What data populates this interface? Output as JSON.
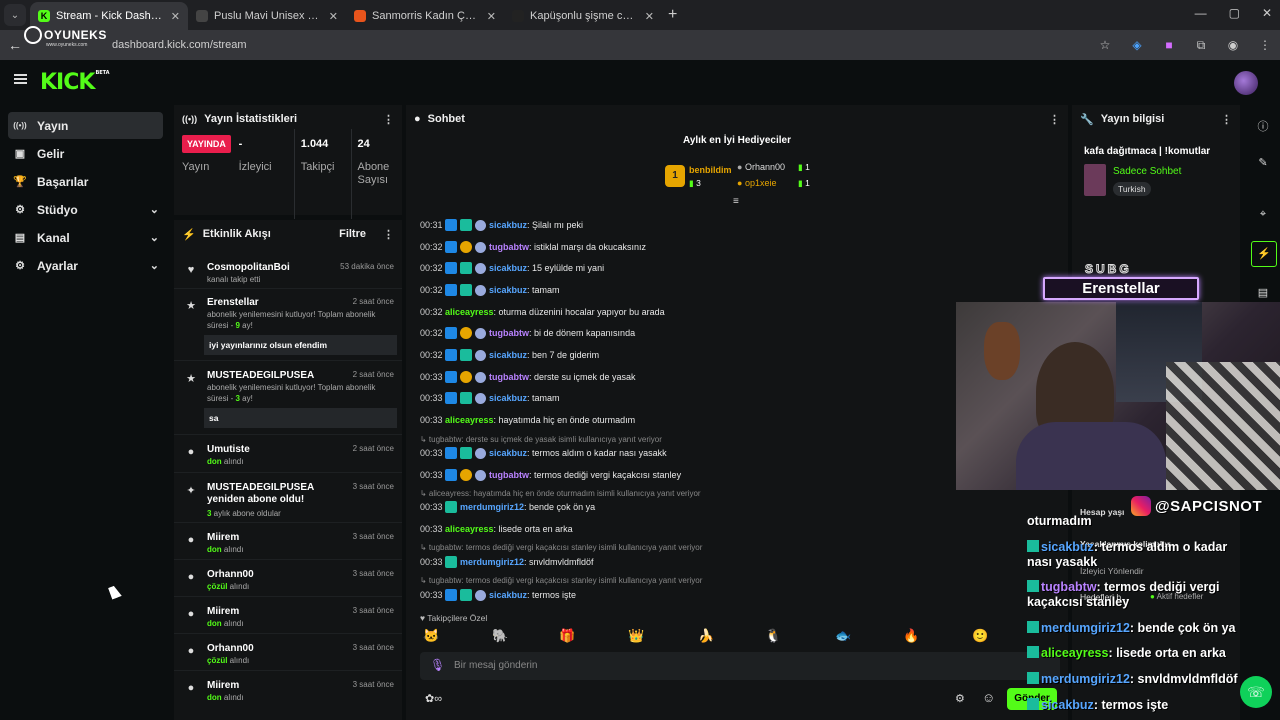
{
  "browser": {
    "tabs": [
      {
        "label": "Stream - Kick Dashboard",
        "favicon_color": "#53fc18",
        "favicon_glyph": "K"
      },
      {
        "label": "Puslu Mavi Unisex Çanta Mecl",
        "favicon_color": "#444444",
        "favicon_glyph": ""
      },
      {
        "label": "Sanmorris Kadın Çok Gözlü Kul",
        "favicon_color": "#e8541c",
        "favicon_glyph": ""
      },
      {
        "label": "Kapüşonlu şişme ceket - Cekel",
        "favicon_color": "#222222",
        "favicon_glyph": ""
      }
    ],
    "url": "dashboard.kick.com/stream",
    "watermark": {
      "name": "OYUNEKS",
      "sub": "www.oyuneks.com"
    }
  },
  "kick": {
    "logo": "KICK",
    "logo_tag": "BETA"
  },
  "sidebar": {
    "items": [
      {
        "label": "Yayın",
        "icon": "broadcast-icon",
        "glyph": "((•))",
        "chevron": false
      },
      {
        "label": "Gelir",
        "icon": "money-icon",
        "glyph": "▣",
        "chevron": false
      },
      {
        "label": "Başarılar",
        "icon": "trophy-icon",
        "glyph": "🏆",
        "chevron": false
      },
      {
        "label": "Stüdyo",
        "icon": "studio-icon",
        "glyph": "⚙",
        "chevron": true
      },
      {
        "label": "Kanal",
        "icon": "channel-icon",
        "glyph": "▤",
        "chevron": true
      },
      {
        "label": "Ayarlar",
        "icon": "settings-icon",
        "glyph": "⚙",
        "chevron": true
      }
    ]
  },
  "stats": {
    "title": "Yayın İstatistikleri",
    "live": "YAYINDA",
    "live_label": "Yayın",
    "viewers_value": "-",
    "viewers_label": "İzleyici",
    "followers_value": "1.044",
    "followers_label": "Takipçi",
    "subs_value": "24",
    "subs_label": "Abone Sayısı"
  },
  "activity": {
    "title": "Etkinlik Akışı",
    "filter": "Filtre",
    "items": [
      {
        "icon": "♥",
        "name": "CosmopolitanBoi",
        "time": "53 dakika önce",
        "desc": "kanalı takip etti",
        "msg": ""
      },
      {
        "icon": "★",
        "name": "Erenstellar",
        "time": "2 saat önce",
        "desc": "abonelik yenilemesini kutluyor! Toplam abonelik süresi -",
        "count": "9",
        "suffix": " ay!",
        "msg": "iyi yayınlarınız olsun efendim"
      },
      {
        "icon": "★",
        "name": "MUSTEADEGILPUSEA",
        "time": "2 saat önce",
        "desc": "abonelik yenilemesini kutluyor! Toplam abonelik süresi -",
        "count": "3",
        "suffix": " ay!",
        "msg": "sa"
      },
      {
        "icon": "●",
        "name": "Umutiste",
        "time": "2 saat önce",
        "gift": "don",
        "desc": " alındı",
        "msg": ""
      },
      {
        "icon": "✦",
        "name": "MUSTEADEGILPUSEA yeniden abone oldu!",
        "time": "3 saat önce",
        "count": "3",
        "desc": " aylık abone oldular",
        "msg": ""
      },
      {
        "icon": "●",
        "name": "Miirem",
        "time": "3 saat önce",
        "gift": "don",
        "desc": " alındı",
        "msg": ""
      },
      {
        "icon": "●",
        "name": "Orhann00",
        "time": "3 saat önce",
        "gift": "çözül",
        "desc": " alındı",
        "msg": ""
      },
      {
        "icon": "●",
        "name": "Miirem",
        "time": "3 saat önce",
        "gift": "don",
        "desc": " alındı",
        "msg": ""
      },
      {
        "icon": "●",
        "name": "Orhann00",
        "time": "3 saat önce",
        "gift": "çözül",
        "desc": " alındı",
        "msg": ""
      },
      {
        "icon": "●",
        "name": "Miirem",
        "time": "3 saat önce",
        "gift": "don",
        "desc": " alındı",
        "msg": ""
      }
    ]
  },
  "chat": {
    "title": "Sohbet",
    "top_gifters_title": "Aylık en İyi Hediyeciler",
    "gifters": [
      {
        "rank": "1",
        "name": "benbildim",
        "count": "3"
      },
      {
        "rank": "",
        "name": "Orhann00",
        "count": "1"
      },
      {
        "rank": "",
        "name": "op1xeie",
        "count": "1"
      }
    ],
    "messages": [
      {
        "ts": "00:31",
        "badges": [
          "blue",
          "cyan",
          "snow"
        ],
        "user": "sicakbuz",
        "color": "#57a6ff",
        "text": ": Şilalı mı peki"
      },
      {
        "ts": "00:32",
        "badges": [
          "blue",
          "gold",
          "snow"
        ],
        "user": "tugbabtw",
        "color": "#b983ff",
        "text": ": istiklal marşı da okucaksınız"
      },
      {
        "ts": "00:32",
        "badges": [
          "blue",
          "cyan",
          "snow"
        ],
        "user": "sicakbuz",
        "color": "#57a6ff",
        "text": ": 15 eylülde mi yani"
      },
      {
        "ts": "00:32",
        "badges": [
          "blue",
          "cyan",
          "snow"
        ],
        "user": "sicakbuz",
        "color": "#57a6ff",
        "text": ": tamam"
      },
      {
        "ts": "00:32",
        "badges": [],
        "user": "aliceayress",
        "color": "#53fc18",
        "text": ": oturma düzenini hocalar yapıyor bu arada"
      },
      {
        "ts": "00:32",
        "badges": [
          "blue",
          "gold",
          "snow"
        ],
        "user": "tugbabtw",
        "color": "#b983ff",
        "text": ": bi de dönem kapanısında"
      },
      {
        "ts": "00:32",
        "badges": [
          "blue",
          "cyan",
          "snow"
        ],
        "user": "sicakbuz",
        "color": "#57a6ff",
        "text": ": ben 7 de giderim"
      },
      {
        "ts": "00:33",
        "badges": [
          "blue",
          "gold",
          "snow"
        ],
        "user": "tugbabtw",
        "color": "#b983ff",
        "text": ": derste su içmek de yasak"
      },
      {
        "ts": "00:33",
        "badges": [
          "blue",
          "cyan",
          "snow"
        ],
        "user": "sicakbuz",
        "color": "#57a6ff",
        "text": ": tamam"
      },
      {
        "ts": "00:33",
        "badges": [],
        "user": "aliceayress",
        "color": "#53fc18",
        "text": ": hayatımda hiç en önde oturmadım"
      },
      {
        "reply": "↳ tugbabtw: derste su içmek de yasak isimli kullanıcıya yanıt veriyor"
      },
      {
        "ts": "00:33",
        "badges": [
          "blue",
          "cyan",
          "snow"
        ],
        "user": "sicakbuz",
        "color": "#57a6ff",
        "text": ": termos aldım o kadar nası yasakk"
      },
      {
        "ts": "00:33",
        "badges": [
          "blue",
          "gold",
          "snow"
        ],
        "user": "tugbabtw",
        "color": "#b983ff",
        "text": ": termos dediği vergi kaçakcısı stanley"
      },
      {
        "reply": "↳ aliceayress: hayatımda hiç en önde oturmadım isimli kullanıcıya yanıt veriyor"
      },
      {
        "ts": "00:33",
        "badges": [
          "cyan"
        ],
        "user": "merdumgiriz12",
        "color": "#57a6ff",
        "text": ": bende çok ön ya"
      },
      {
        "ts": "00:33",
        "badges": [],
        "user": "aliceayress",
        "color": "#53fc18",
        "text": ": lisede orta en arka"
      },
      {
        "reply": "↳ tugbabtw: termos dediği vergi kaçakcısı stanley isimli kullanıcıya yanıt veriyor"
      },
      {
        "ts": "00:33",
        "badges": [
          "cyan"
        ],
        "user": "merdumgiriz12",
        "color": "#57a6ff",
        "text": ": snvldmvldmfldöf"
      },
      {
        "reply": "↳ tugbabtw: termos dediği vergi kaçakcısı stanley isimli kullanıcıya yanıt veriyor"
      },
      {
        "ts": "00:33",
        "badges": [
          "blue",
          "cyan",
          "snow"
        ],
        "user": "sicakbuz",
        "color": "#57a6ff",
        "text": ": termos işte"
      }
    ],
    "followers_only": "Takipçilere Özel",
    "emotes": [
      "🐱",
      "🐘",
      "🎁",
      "👑",
      "🍌",
      "🐧",
      "🐟",
      "🔥",
      "🙂"
    ],
    "input_placeholder": "Bir mesaj gönderin",
    "send": "Gönder"
  },
  "stream_info": {
    "title": "Yayın bilgisi",
    "stream_title": "kafa dağıtmaca | !komutlar",
    "category": "Sadece Sohbet",
    "language": "Turkish"
  },
  "overlay": {
    "sub_tag": "SUBG",
    "sub_name": "Erenstellar",
    "instagram": "@SAPCISNOT",
    "under_labels": [
      "Hesap yaşı",
      "Yasaklanmış kelimeler",
      "İzleyici Yönlendir",
      "Hedefleri b...",
      "Aktif hedefler"
    ],
    "chat": [
      {
        "user": "",
        "color": "#ffffff",
        "text": "oturmadım"
      },
      {
        "user": "sicakbuz",
        "color": "#57a6ff",
        "text": ": termos aldım o kadar nası yasakk"
      },
      {
        "user": "tugbabtw",
        "color": "#b983ff",
        "text": ": termos dediği vergi kaçakcısı stanley"
      },
      {
        "user": "merdumgiriz12",
        "color": "#57a6ff",
        "text": ": bende çok ön ya"
      },
      {
        "user": "aliceayress",
        "color": "#53fc18",
        "text": ": lisede orta en arka"
      },
      {
        "user": "merdumgiriz12",
        "color": "#57a6ff",
        "text": ": snvldmvldmfldöf"
      },
      {
        "user": "sicakbuz",
        "color": "#57a6ff",
        "text": ": termos işte"
      }
    ]
  }
}
